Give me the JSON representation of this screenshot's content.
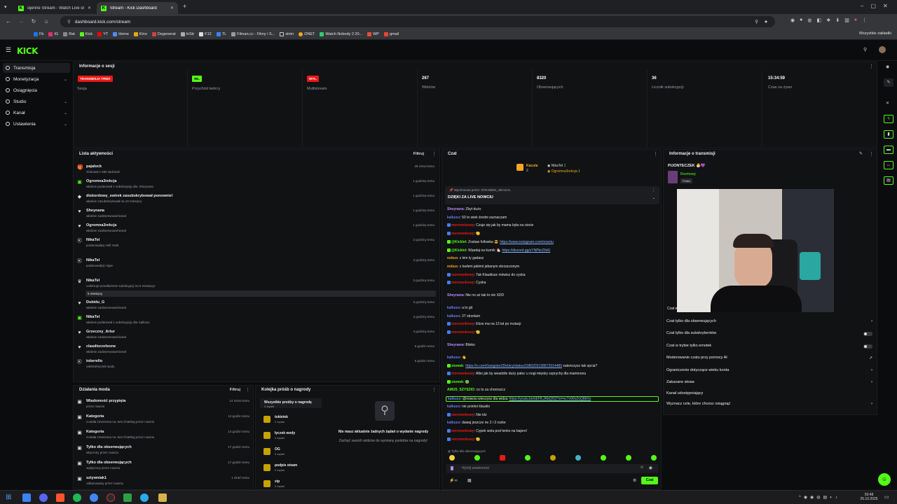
{
  "browser": {
    "tabs": [
      {
        "title": "sijenne Stream - Watch Live on...",
        "active": false
      },
      {
        "title": "Stream - Kick Dashboard",
        "active": true
      }
    ],
    "new_tab": "+",
    "url": "dashboard.kick.com/stream",
    "bookmarks": [
      "Fb",
      "IG",
      "Rat",
      "Kick",
      "YT",
      "Home",
      "Kino",
      "Degenerat",
      "InStr",
      "F12",
      "TL",
      "Filman.cc - Filmy i S...",
      "strim",
      "ONET",
      "Watch Nobody 2 20...",
      "WP",
      "gmail"
    ],
    "all_bookmarks": "Wszystkie zakładki"
  },
  "app": {
    "logo": "KICK"
  },
  "sidebar": {
    "items": [
      {
        "label": "Transmisja",
        "selected": true,
        "chevron": false
      },
      {
        "label": "Monetyzacja",
        "selected": false,
        "chevron": true
      },
      {
        "label": "Osiągnięcia",
        "selected": false,
        "chevron": false
      },
      {
        "label": "Studio",
        "selected": false,
        "chevron": true
      },
      {
        "label": "Kanał",
        "selected": false,
        "chevron": true
      },
      {
        "label": "Ustawienia",
        "selected": false,
        "chevron": true
      }
    ]
  },
  "session": {
    "title": "Informacje o sesji",
    "cells": [
      {
        "badge": "TRANSMISJA TRWA",
        "badge_color": "#e91916",
        "label": "Sesja"
      },
      {
        "badge": "WŁ.",
        "badge_color": "#53fc18",
        "label": "Przychód twórcy"
      },
      {
        "badge": "WYŁ.",
        "badge_color": "#e91916",
        "label": "Multistream"
      },
      {
        "value": "267",
        "label": "Widzów"
      },
      {
        "value": "8320",
        "label": "Obserwujących"
      },
      {
        "value": "36",
        "label": "Licznik subskrypcji"
      },
      {
        "value": "15:34:59",
        "label": "Czas na żywo"
      }
    ]
  },
  "activity": {
    "title": "Lista aktywności",
    "filter": "Filtruj",
    "items": [
      {
        "icon": "gift-icon",
        "name": "pajalock",
        "desc": "zbolował z 650 widzami!",
        "time": "28 minut temu"
      },
      {
        "icon": "sub-icon",
        "name": "Ogromna3rekcja",
        "desc": "właśnie podarował 1 subskrypcję dla: Sheynana",
        "time": "1 godzinę temu"
      },
      {
        "icon": "star-icon",
        "name": "diskordowy_swirek zasubskrybował ponownie!",
        "desc": "właśnie zasubskrybował na 10 miesięcy",
        "time": "1 godzinę temu"
      },
      {
        "icon": "heart-icon",
        "name": "Sheynana",
        "desc": "właśnie zaobserwował kanał",
        "time": "1 godzinę temu"
      },
      {
        "icon": "heart-icon",
        "name": "Ogromna3rekcja",
        "desc": "właśnie zaobserwował kanał",
        "time": "1 godzinę temu"
      },
      {
        "icon": "kick-icon",
        "name": "NikaTel",
        "desc": "podarował(a) Hell Yeah",
        "time": "2 godziny temu"
      },
      {
        "icon": "kick-icon",
        "name": "NikaTel",
        "desc": "podarował(a) Hype",
        "time": "2 godziny temu"
      },
      {
        "icon": "crown-icon",
        "name": "NikaTel",
        "desc": "celebruje przedłużenie subskrypcji na 5 miesięcy!",
        "time": "3 godziny temu",
        "note": "5 miesięcy"
      },
      {
        "icon": "heart-icon",
        "name": "Dubidu_G",
        "desc": "właśnie zaobserwował kanał",
        "time": "3 godziny temu"
      },
      {
        "icon": "sub-icon",
        "name": "NikaTel",
        "desc": "właśnie podarował 1 subskrypcję dla: kalkuss",
        "time": "3 godziny temu"
      },
      {
        "icon": "heart-icon",
        "name": "Grzeczny_Artur",
        "desc": "właśnie zaobserwował kanał",
        "time": "4 godziny temu"
      },
      {
        "icon": "heart-icon",
        "name": "claudiocorleone",
        "desc": "właśnie zaobserwował kanał",
        "time": "5 godzin temu"
      },
      {
        "icon": "kick-icon",
        "name": "toberello",
        "desc": "odebrał łyczek wody",
        "time": "6 godzin temu"
      }
    ]
  },
  "mod": {
    "title": "Działania moda",
    "filter": "Filtruj",
    "items": [
      {
        "name": "Wiadomość przypięta",
        "desc": "przez nowciu",
        "time": "14 minut temu"
      },
      {
        "name": "Kategoria",
        "desc": "została zmieniona na Just Chatting przez nowciu",
        "time": "12 godzin temu"
      },
      {
        "name": "Kategoria",
        "desc": "została zmieniona na Just Chatting przez nowciu",
        "time": "13 godzin temu"
      },
      {
        "name": "Tylko dla obserwujących",
        "desc": "włączony przez nowciu",
        "time": "17 godzin temu"
      },
      {
        "name": "Tylko dla obserwujących",
        "desc": "wyłączony przez nowciu",
        "time": "17 godzin temu"
      },
      {
        "name": "sztywniak1",
        "desc": "odbanowany przez nowciu",
        "time": "1 dzień temu"
      }
    ]
  },
  "rewards": {
    "title": "Kolejka próśb o nagrody",
    "all": "Wszystkie prośby o nagrodę",
    "all_count": "0 żądań",
    "items": [
      {
        "name": "tokietek",
        "count": "0 żądań"
      },
      {
        "name": "łyczek wody",
        "count": "0 żądań"
      },
      {
        "name": "OG",
        "count": "0 żądań"
      },
      {
        "name": "podpis steam",
        "count": "0 żądań"
      },
      {
        "name": "vip",
        "count": "0 żądań"
      }
    ],
    "empty_title": "Nie masz aktualnie żadnych żądań o wydanie nagrody",
    "empty_desc": "Zachęć swoich widzów do wymiany punktów na nagrody!"
  },
  "chat": {
    "title": "Czat",
    "top": [
      {
        "name": "Kacula",
        "count": "2"
      },
      {
        "name": "NikaTel",
        "count": "1"
      },
      {
        "name": "Ogromna3rekcja",
        "count": "1"
      }
    ],
    "pinned_by": "Wyróżnione przez: STEAWEN_SEAGAL",
    "pinned_text": "DZIĘKI ZA LIVE NOWCIU",
    "lines": [
      {
        "user": "Sheynana",
        "color": "#b78cff",
        "text": ": Zbyt dużo"
      },
      {
        "user": "kalkuss",
        "color": "#6b7bff",
        "text": ": 50 to wiek średni zaznaczam"
      },
      {
        "user": "mormonkowy",
        "color": "#e91916",
        "text": ": Czuje się jak by mama była na ciecie"
      },
      {
        "user": "mormonkowy",
        "color": "#e91916",
        "text": ": 🫡"
      },
      {
        "user": "@Kicklet",
        "color": "#53fc18",
        "text": ": Zostaw followka 😎",
        "link": "https://www.instagram.com/nowciu"
      },
      {
        "user": "@Kicklet",
        "color": "#53fc18",
        "text": ": Wpadaj na kurnik 🐔",
        "link": "https://discord.gg/zYNPbrZ9dU"
      },
      {
        "user": "nobus",
        "color": "#f5a623",
        "text": ": z kim ty gadasz"
      },
      {
        "user": "nobus",
        "color": "#f5a623",
        "text": ": z karłem jakimś jebanym skrzaczonym"
      },
      {
        "user": "mormonkowy",
        "color": "#e91916",
        "text": ": Tak Klaudiusz mówisz do cyoka"
      },
      {
        "user": "mormonkowy",
        "color": "#e91916",
        "text": ": Cyoka"
      },
      {
        "user": "Sheynana",
        "color": "#b78cff",
        "text": ": Nie no aż tak to nie XDD"
      },
      {
        "user": "kalkuss",
        "color": "#6b7bff",
        "text": ": a to git"
      },
      {
        "user": "kalkuss",
        "color": "#6b7bff",
        "text": ": 27 strzelam"
      },
      {
        "user": "mormonkowy",
        "color": "#e91916",
        "text": ": Ekos ma na 13 lat po mutacji"
      },
      {
        "user": "mormonkowy",
        "color": "#e91916",
        "text": ": 🫡"
      },
      {
        "user": "Sheynana",
        "color": "#b78cff",
        "text": ": Blisko"
      },
      {
        "user": "kalkuss",
        "color": "#6b7bff",
        "text": ": 👋"
      },
      {
        "user": "ziomek",
        "color": "#53fc18",
        "text": ":",
        "link": "https://x.com/GangsterZDebicy/status/1980203138672914489",
        "tail": " zatenczysz tak opcia?"
      },
      {
        "user": "mormonkowy",
        "color": "#e91916",
        "text": ": Albo jak by weadzile duży palec u nogi między szprychy dla mammona"
      },
      {
        "user": "ziomek",
        "color": "#53fc18",
        "text": ": 🟢"
      },
      {
        "user": "AMUS_SZYSZIO",
        "color": "#53fc18",
        "text": ": co to za choroszcz"
      },
      {
        "user": "kalkuss",
        "color": "#6b7bff",
        "text": ": @nowciu wieczysz dla widza",
        "link": "https://youtu.be/sEFfLJAbQ5Q?si=nc7v90xZoQ8tIXs"
      },
      {
        "user": "kalkuss",
        "color": "#6b7bff",
        "text": ": nie pointoi klaudio"
      },
      {
        "user": "mormonkowy",
        "color": "#e91916",
        "text": ": Nie idz"
      },
      {
        "user": "kalkuss",
        "color": "#6b7bff",
        "text": ": dawaj jeszcze ne 2 i 3 rozke"
      },
      {
        "user": "mormonkowy",
        "color": "#e91916",
        "text": ": Cypek wola pod tenko na bajere!"
      },
      {
        "user": "mormonkowy",
        "color": "#e91916",
        "text": ": 🫡"
      }
    ],
    "followers_only": "Tylko dla obserwujących",
    "input_placeholder": "Wyślij wiadomość",
    "send": "Czat"
  },
  "stream_info": {
    "title": "Informacje o transmisji",
    "streamer": "PIJONTECZEK 🐣💜",
    "category": "Rozmowy",
    "tag": "Polish",
    "settings": [
      {
        "label": "Czat tylko dla obserwujących",
        "control": "arrow"
      },
      {
        "label": "Czat tylko dla subskrybentów",
        "control": "toggle"
      },
      {
        "label": "Czat w trybie tylko emotek",
        "control": "toggle"
      },
      {
        "label": "Moderowanie czatu przy pomocy AI",
        "control": "external"
      },
      {
        "label": "Ograniczenie dotyczące wieku konta",
        "control": "arrow"
      },
      {
        "label": "Zakazane słowa",
        "control": "arrow"
      },
      {
        "label": "Kanał udostępniający",
        "control": "none"
      },
      {
        "label": "Wyznacz cele, które chcesz osiągnąć",
        "control": "arrow"
      }
    ],
    "partial_label": "Czat w"
  },
  "taskbar": {
    "time": "03:48",
    "date": "25.10.2025"
  },
  "colors": {
    "kick_green": "#53fc18",
    "live_red": "#e91916",
    "panel": "#111214"
  }
}
